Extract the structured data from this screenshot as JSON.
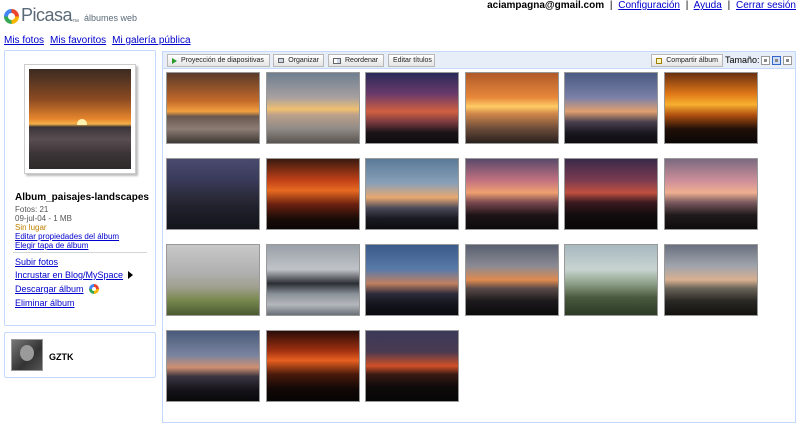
{
  "header": {
    "brand": "Picasa",
    "brand_tm": "™",
    "brand_sub": "álbumes web",
    "user_email": "aciampagna@gmail.com",
    "links": [
      "Configuración",
      "Ayuda",
      "Cerrar sesión"
    ],
    "separator": "|"
  },
  "nav": {
    "items": [
      "Mis fotos",
      "Mis favoritos",
      "Mi galería pública"
    ]
  },
  "album": {
    "title": "Album_paisajes-landscapes",
    "photos": "Fotos: 21",
    "date_size": "09-jul-04 - 1 MB",
    "location": "Sin lugar",
    "edit_link": "Editar propiedades del álbum",
    "cover_link": "Elegir tapa de álbum",
    "actions": {
      "upload": "Subir fotos",
      "embed": "Incrustar en Blog/MySpace",
      "download": "Descargar álbum",
      "delete": "Eliminar álbum"
    }
  },
  "user": {
    "name": "GZTK"
  },
  "toolbar": {
    "slideshow": "Proyección de diapositivas",
    "organize": "Organizar",
    "reorder": "Reordenar",
    "edit_titles": "Editar títulos",
    "share": "Compartir álbum",
    "size_label": "Tamaño:"
  },
  "thumbnails": [
    {
      "name": "sunset-beach-1",
      "bg": "linear-gradient(#5a3a2a 0%,#c46a2a 40%,#f2a040 55%,#6a5850 62%,#8c7c74 80%,#3e3834 100%)"
    },
    {
      "name": "sunset-beach-2",
      "bg": "linear-gradient(#6f7f90 0%,#a8a0a0 35%,#f0c070 52%,#bba08a 60%,#8f8a86 80%,#5a5450 100%)"
    },
    {
      "name": "dusk-clouds-red",
      "bg": "linear-gradient(#2a2a5a 0%,#6a3a6a 30%,#d06040 55%,#7a3a40 70%,#1a1418 85%,#0e0c0e 100%)"
    },
    {
      "name": "sunset-sun-water",
      "bg": "linear-gradient(#b05a2a 0%,#e8883a 35%,#ffcc66 48%,#d0884a 58%,#6a4a3a 80%,#2a201c 100%)"
    },
    {
      "name": "city-dusk-blue",
      "bg": "linear-gradient(#4a5a80 0%,#7a80a8 35%,#e0a070 55%,#4a4050 70%,#1a1820 85%,#0e0c10 100%)"
    },
    {
      "name": "golden-clouds-city",
      "bg": "linear-gradient(#6a3010 0%,#e07818 30%,#f8b030 45%,#b05010 60%,#201008 80%,#0a0604 100%)"
    },
    {
      "name": "city-lights-aerial",
      "bg": "linear-gradient(#4a4a70 0%,#3a3a5a 30%,#2a2a3a 55%,#1e1e28 75%,#14141c 100%)"
    },
    {
      "name": "red-sky-silhouette",
      "bg": "linear-gradient(#3a1a10 0%,#c04018 30%,#e86a20 45%,#6a2010 65%,#1a0c08 85%,#0a0606 100%)"
    },
    {
      "name": "blue-dusk-city",
      "bg": "linear-gradient(#5a7a98 0%,#8aa0b8 35%,#e8a870 55%,#4a4a5a 70%,#1a1a22 85%,#0c0c10 100%)"
    },
    {
      "name": "pink-sunset-city",
      "bg": "linear-gradient(#5a4a6a 0%,#c07080 30%,#f0a070 48%,#7a4a50 62%,#1e1418 80%,#0c0a0c 100%)"
    },
    {
      "name": "purple-dusk-buildings",
      "bg": "linear-gradient(#3a2a4a 0%,#7a3a50 30%,#c05040 48%,#3a1a20 62%,#120c0e 80%,#080608 100%)"
    },
    {
      "name": "rose-sky-city",
      "bg": "linear-gradient(#7a6a80 0%,#d0909a 32%,#f0b090 48%,#7a5a60 62%,#201a1c 80%,#0e0c0e 100%)"
    },
    {
      "name": "rainbow-hills",
      "bg": "linear-gradient(#c8c8c8 0%,#b0b0b0 40%,#a0a090 60%,#7a8a50 78%,#4a5a30 100%)"
    },
    {
      "name": "lake-mountains",
      "bg": "linear-gradient(#9aa0a8 0%,#c0c4c8 35%,#2a2e34 55%,#8a9098 70%,#b4b8bc 85%,#6a7078 100%)"
    },
    {
      "name": "blue-night-city",
      "bg": "linear-gradient(#3a5a8a 0%,#5a7aa8 35%,#c08060 55%,#2a2a3a 70%,#14141c 85%,#0a0a10 100%)"
    },
    {
      "name": "grey-clouds-sunset",
      "bg": "linear-gradient(#5a6070 0%,#8a8a94 30%,#e08a50 50%,#5a4a48 62%,#1c1a1c 80%,#0c0c0c 100%)"
    },
    {
      "name": "green-plain-haze",
      "bg": "linear-gradient(#a8b8c0 0%,#c8d4d0 35%,#8ea088 55%,#4a5a40 75%,#2a3a24 100%)"
    },
    {
      "name": "overcast-dusk-plain",
      "bg": "linear-gradient(#6a7080 0%,#a0a4ac 30%,#d8b090 50%,#6a6458 62%,#2a2824 80%,#14120e 100%)"
    },
    {
      "name": "dusk-blue-silhouette",
      "bg": "linear-gradient(#4a5a7a 0%,#7a84a0 35%,#d09070 52%,#3a3440 65%,#141218 85%,#08080a 100%)"
    },
    {
      "name": "fire-sky-city",
      "bg": "linear-gradient(#2a0c08 0%,#a03010 28%,#e86020 42%,#4a1a0c 62%,#120806 82%,#060404 100%)"
    },
    {
      "name": "dark-orange-horizon",
      "bg": "linear-gradient(#3a3a5a 0%,#4a3a50 30%,#d05028 50%,#3a1a14 62%,#0e0a0a 80%,#060606 100%)"
    }
  ]
}
